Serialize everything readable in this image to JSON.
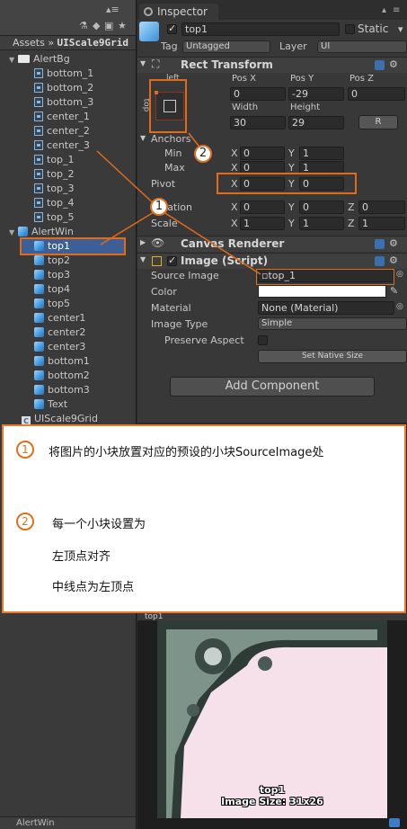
{
  "hierarchy": {
    "assets_label": "Assets",
    "assets_sep": "»",
    "assets_folder": "UIScale9Grid",
    "items": [
      {
        "label": "AlertBg"
      },
      {
        "label": "bottom_1"
      },
      {
        "label": "bottom_2"
      },
      {
        "label": "bottom_3"
      },
      {
        "label": "center_1"
      },
      {
        "label": "center_2"
      },
      {
        "label": "center_3"
      },
      {
        "label": "top_1"
      },
      {
        "label": "top_2"
      },
      {
        "label": "top_3"
      },
      {
        "label": "top_4"
      },
      {
        "label": "top_5"
      },
      {
        "label": "AlertWin"
      },
      {
        "label": "top1"
      },
      {
        "label": "top2"
      },
      {
        "label": "top3"
      },
      {
        "label": "top4"
      },
      {
        "label": "top5"
      },
      {
        "label": "center1"
      },
      {
        "label": "center2"
      },
      {
        "label": "center3"
      },
      {
        "label": "bottom1"
      },
      {
        "label": "bottom2"
      },
      {
        "label": "bottom3"
      },
      {
        "label": "Text"
      },
      {
        "label": "UIScale9Grid"
      }
    ],
    "bottom_label": "AlertWin"
  },
  "inspector": {
    "tab_label": "Inspector",
    "object_name": "top1",
    "static_label": "Static",
    "tag_label": "Tag",
    "tag_value": "Untagged",
    "layer_label": "Layer",
    "layer_value": "UI",
    "rect_transform": {
      "title": "Rect Transform",
      "anchor_h": "left",
      "anchor_v": "top",
      "pos_x_label": "Pos X",
      "pos_y_label": "Pos Y",
      "pos_z_label": "Pos Z",
      "pos_x": "0",
      "pos_y": "-29",
      "pos_z": "0",
      "width_label": "Width",
      "height_label": "Height",
      "width": "30",
      "height": "29",
      "raw_button": "R",
      "anchors_label": "Anchors",
      "min_label": "Min",
      "max_label": "Max",
      "pivot_label": "Pivot",
      "min_x": "0",
      "min_y": "1",
      "max_x": "0",
      "max_y": "1",
      "pivot_x": "0",
      "pivot_y": "0",
      "rotation_label": "Rotation",
      "scale_label": "Scale",
      "rot_x": "0",
      "rot_y": "0",
      "rot_z": "0",
      "scale_x": "1",
      "scale_y": "1",
      "scale_z": "1",
      "x_label": "X",
      "y_label": "Y",
      "z_label": "Z"
    },
    "canvas_renderer": {
      "title": "Canvas Renderer"
    },
    "image": {
      "title": "Image (Script)",
      "source_image_label": "Source Image",
      "source_image_value": "top_1",
      "color_label": "Color",
      "material_label": "Material",
      "material_value": "None (Material)",
      "image_type_label": "Image Type",
      "image_type_value": "Simple",
      "preserve_aspect_label": "Preserve Aspect",
      "set_native_size": "Set Native Size"
    },
    "add_component": "Add Component"
  },
  "annotations": {
    "circle1": "1",
    "circle2": "2"
  },
  "note": {
    "items": [
      {
        "num": "1",
        "text": "将图片的小块放置对应的预设的小块SourceImage处"
      },
      {
        "num": "2",
        "text": "每一个小块设置为"
      }
    ],
    "line3": "左顶点对齐",
    "line4": "中线点为左顶点"
  },
  "preview": {
    "header": "top1",
    "name": "top1",
    "size": "Image Size: 31x26"
  },
  "colors": {
    "accent": "#e06b1a",
    "selection": "#3e5f96",
    "preview_bg": "#f6e0ea"
  }
}
